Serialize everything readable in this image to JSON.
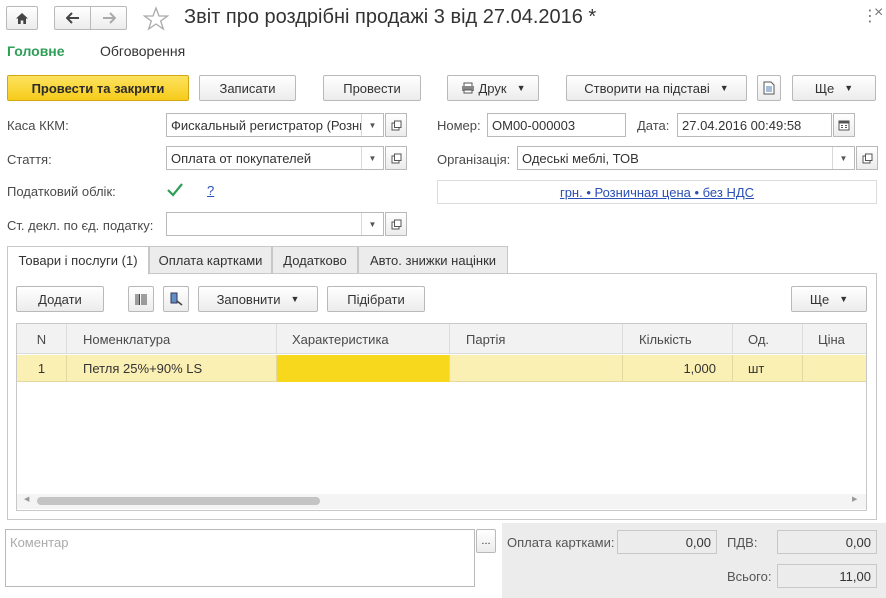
{
  "window": {
    "title": "Звіт про роздрібні продажі 3 від 27.04.2016 *"
  },
  "nav_tabs": {
    "main": "Головне",
    "discussion": "Обговорення"
  },
  "toolbar": {
    "post_close": "Провести та закрити",
    "save": "Записати",
    "post": "Провести",
    "print": "Друк",
    "create_based": "Створити на підставі",
    "more": "Ще"
  },
  "form": {
    "kasa_label": "Каса ККМ:",
    "kasa_value": "Фискальный регистратор (Розни",
    "number_label": "Номер:",
    "number_value": "ОМ00-000003",
    "date_label": "Дата:",
    "date_value": "27.04.2016 00:49:58",
    "article_label": "Стаття:",
    "article_value": "Оплата от покупателей",
    "org_label": "Організація:",
    "org_value": "Одеські меблі, ТОВ",
    "tax_label": "Податковий облік:",
    "tax_help": "?",
    "price_link": "грн. • Розничная цена • без НДС",
    "decl_label": "Ст. декл. по єд. податку:",
    "decl_value": ""
  },
  "tabs": [
    {
      "label": "Товари і послуги (1)"
    },
    {
      "label": "Оплата картками"
    },
    {
      "label": "Додатково"
    },
    {
      "label": "Авто. знижки націнки"
    }
  ],
  "table_toolbar": {
    "add": "Додати",
    "fill": "Заповнити",
    "pick": "Підібрати",
    "more": "Ще"
  },
  "table": {
    "columns": [
      "N",
      "Номенклатура",
      "Характеристика",
      "Партія",
      "Кількість",
      "Од.",
      "Ціна"
    ],
    "rows": [
      {
        "n": "1",
        "item": "Петля  25%+90% LS",
        "characteristic": "",
        "batch": "",
        "qty": "1,000",
        "unit": "шт",
        "price": ""
      }
    ]
  },
  "comment": {
    "placeholder": "Коментар",
    "button": "..."
  },
  "totals": {
    "cards_label": "Оплата картками:",
    "cards_value": "0,00",
    "vat_label": "ПДВ:",
    "vat_value": "0,00",
    "total_label": "Всього:",
    "total_value": "11,00"
  },
  "colors": {
    "accent_green": "#2f9e57",
    "primary_yellow": "#f6cb1a",
    "row_highlight": "#fbf0b4",
    "cell_selected": "#f8d81c",
    "link_blue": "#2a4fb5"
  }
}
